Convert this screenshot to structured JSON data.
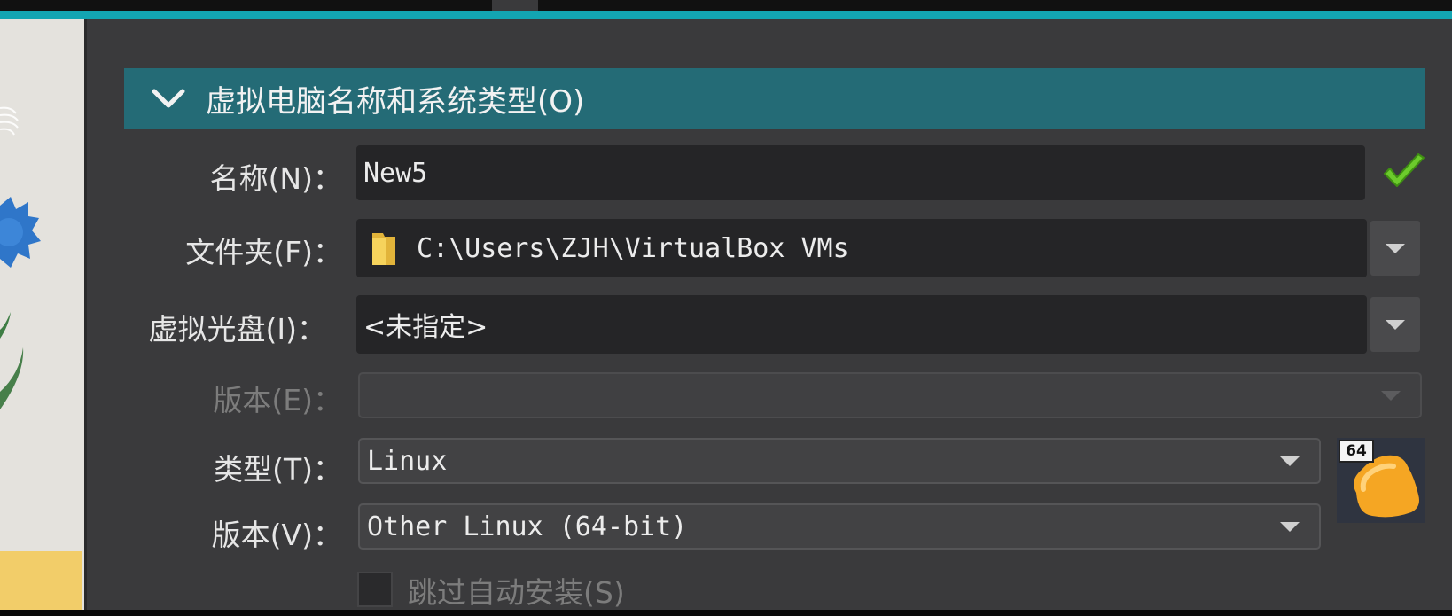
{
  "section": {
    "title": "虚拟电脑名称和系统类型(O)"
  },
  "form": {
    "name": {
      "label": "名称(N)：",
      "value": "New5"
    },
    "folder": {
      "label": "文件夹(F)：",
      "value": "C:\\Users\\ZJH\\VirtualBox VMs"
    },
    "iso": {
      "label": "虚拟光盘(I)：",
      "value": "<未指定>"
    },
    "edition": {
      "label": "版本(E)：",
      "value": ""
    },
    "type": {
      "label": "类型(T)：",
      "value": "Linux"
    },
    "version": {
      "label": "版本(V)：",
      "value": "Other Linux (64-bit)"
    },
    "unattended": {
      "label": "跳过自动安装(S)",
      "checked": false
    }
  },
  "os_badge": {
    "text": "64",
    "icon": "linux-os-icon"
  },
  "colors": {
    "accent": "#13a5b2",
    "header": "#246b76",
    "valid": "#6ccb2c"
  }
}
